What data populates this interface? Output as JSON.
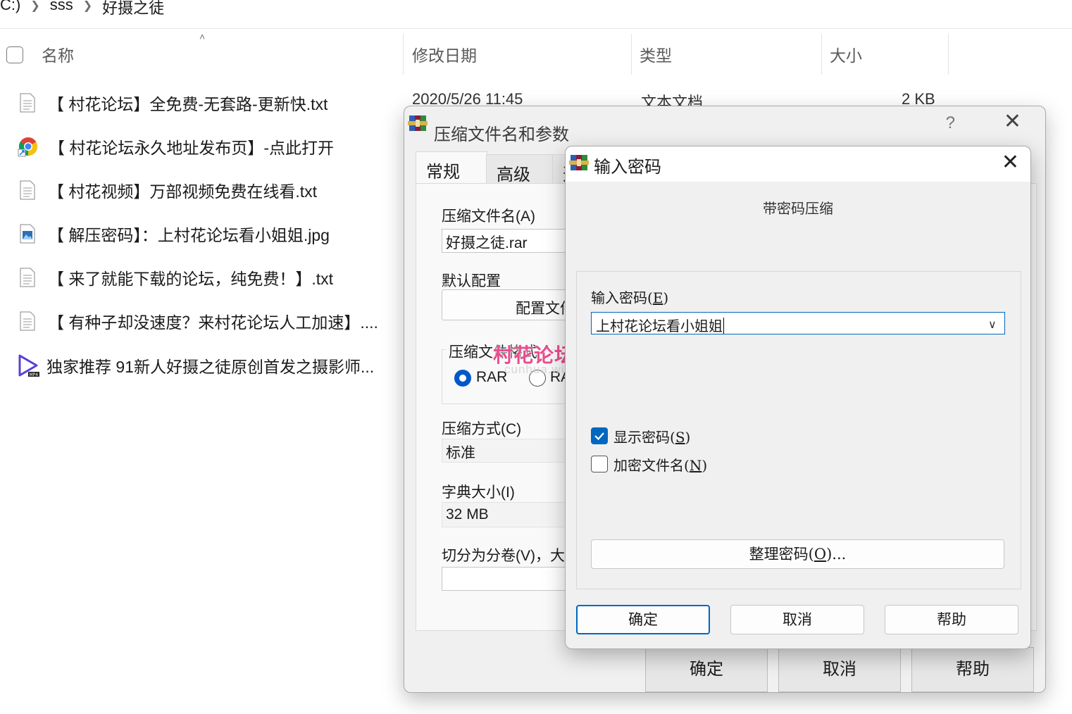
{
  "explorer": {
    "breadcrumb": [
      "C:)",
      "sss",
      "好摄之徒"
    ],
    "columns": {
      "name": "名称",
      "modified": "修改日期",
      "type": "类型",
      "size": "大小"
    },
    "files": [
      {
        "name": "【 村花论坛】全免费-无套路-更新快.txt",
        "icon": "text-file-icon",
        "modified": "2020/5/26 11:45",
        "type": "文本文档",
        "size": "2 KB"
      },
      {
        "name": "【 村花论坛永久地址发布页】-点此打开",
        "icon": "chrome-shortcut-icon"
      },
      {
        "name": "【 村花视频】万部视频免费在线看.txt",
        "icon": "text-file-icon"
      },
      {
        "name": "【 解压密码】：上村花论坛看小姐姐.jpg",
        "icon": "image-file-icon"
      },
      {
        "name": "【 来了就能下载的论坛，纯免费！】.txt",
        "icon": "text-file-icon"
      },
      {
        "name": "【 有种子却没速度？来村花论坛人工加速】....",
        "icon": "text-file-icon"
      },
      {
        "name": "独家推荐 91新人好摄之徒原创首发之摄影师...",
        "icon": "video-file-icon"
      }
    ]
  },
  "archive_dialog": {
    "title": "压缩文件名和参数",
    "help": "?",
    "tabs": [
      "常规",
      "高级",
      "选"
    ],
    "archive_name_label": "压缩文件名(A)",
    "archive_name_value": "好摄之徒.rar",
    "default_profile_label": "默认配置",
    "profile_button": "配置文件",
    "format_label": "压缩文件格式",
    "format_options": [
      "RAR",
      "RA"
    ],
    "method_label": "压缩方式(C)",
    "method_value": "标准",
    "dict_label": "字典大小(I)",
    "dict_value": "32 MB",
    "split_label": "切分为分卷(V)，大",
    "ok": "确定",
    "cancel": "取消",
    "help_btn": "帮助"
  },
  "password_dialog": {
    "title": "输入密码",
    "subtitle": "带密码压缩",
    "password_label_pre": "输入密码(",
    "password_label_key": "E",
    "password_label_post": ")",
    "password_value": "上村花论坛看小姐姐",
    "show_password_pre": "显示密码(",
    "show_password_key": "S",
    "show_password_post": ")",
    "show_password_checked": true,
    "encrypt_names_pre": "加密文件名(",
    "encrypt_names_key": "N",
    "encrypt_names_post": ")",
    "encrypt_names_checked": false,
    "organize_pre": "整理密码(",
    "organize_key": "O",
    "organize_post": ")...",
    "ok": "确定",
    "cancel": "取消",
    "help": "帮助"
  },
  "watermark": {
    "text": "村花论坛",
    "sub": "cunhua.win"
  },
  "colors": {
    "accent": "#0067c0",
    "watermark": "#ea4d8f"
  }
}
